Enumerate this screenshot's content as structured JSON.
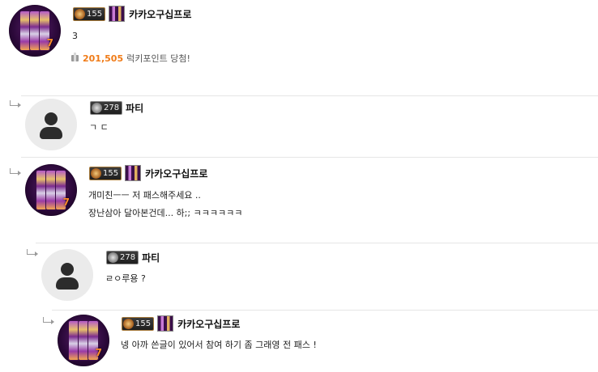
{
  "comments": [
    {
      "nickname": "카카오구십프로",
      "level": "155",
      "lines": [
        "3"
      ],
      "prize": {
        "amount": "201,505",
        "label": "럭키포인트 당첨!"
      }
    },
    {
      "nickname": "파티",
      "level": "278",
      "lines": [
        "ㄱ ㄷ"
      ]
    },
    {
      "nickname": "카카오구십프로",
      "level": "155",
      "lines": [
        "개미친ㅡㅡ 저 패스해주세요 ..",
        "장난삼아 달아본건데... 하;; ㅋㅋㅋㅋㅋㅋ"
      ]
    },
    {
      "nickname": "파티",
      "level": "278",
      "lines": [
        "ㄹㅇ루용 ?"
      ]
    },
    {
      "nickname": "카카오구십프로",
      "level": "155",
      "lines": [
        "넹 아까 쓴글이 있어서 참여 하기 좀 그래영 전 패스 !"
      ]
    }
  ],
  "icons": {
    "reply": "reply-arrow-icon",
    "prize": "gift-icon",
    "default_avatar": "person-icon"
  },
  "colors": {
    "prize_amount": "#f07b17",
    "divider": "#e6e6e6"
  }
}
